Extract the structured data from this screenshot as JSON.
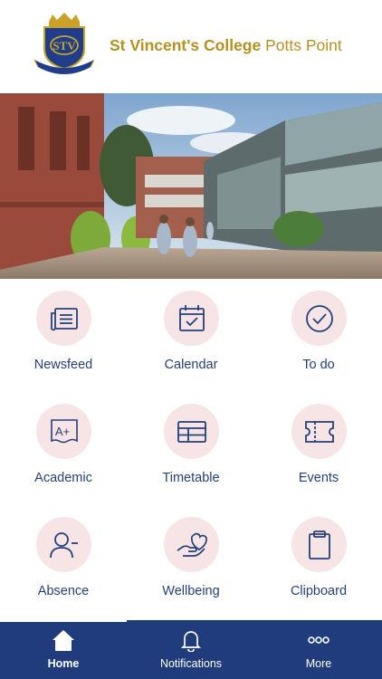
{
  "header": {
    "name_bold": "St Vincent's College",
    "name_light": "Potts Point",
    "crest_text": "STV"
  },
  "tiles": [
    {
      "label": "Newsfeed",
      "icon": "newsfeed-icon"
    },
    {
      "label": "Calendar",
      "icon": "calendar-icon"
    },
    {
      "label": "To do",
      "icon": "todo-check-icon"
    },
    {
      "label": "Academic",
      "icon": "academic-grade-icon"
    },
    {
      "label": "Timetable",
      "icon": "timetable-icon"
    },
    {
      "label": "Events",
      "icon": "events-ticket-icon"
    },
    {
      "label": "Absence",
      "icon": "absence-user-icon"
    },
    {
      "label": "Wellbeing",
      "icon": "wellbeing-hand-heart-icon"
    },
    {
      "label": "Clipboard",
      "icon": "clipboard-icon"
    }
  ],
  "tabbar": {
    "tabs": [
      {
        "label": "Home",
        "icon": "home-icon",
        "active": true
      },
      {
        "label": "Notifications",
        "icon": "bell-icon",
        "active": false
      },
      {
        "label": "More",
        "icon": "more-dots-icon",
        "active": false
      }
    ]
  },
  "colors": {
    "gold": "#b8911d",
    "navy": "#213c7d",
    "label_blue": "#24407e",
    "tile_circle": "#f6e5e4"
  }
}
